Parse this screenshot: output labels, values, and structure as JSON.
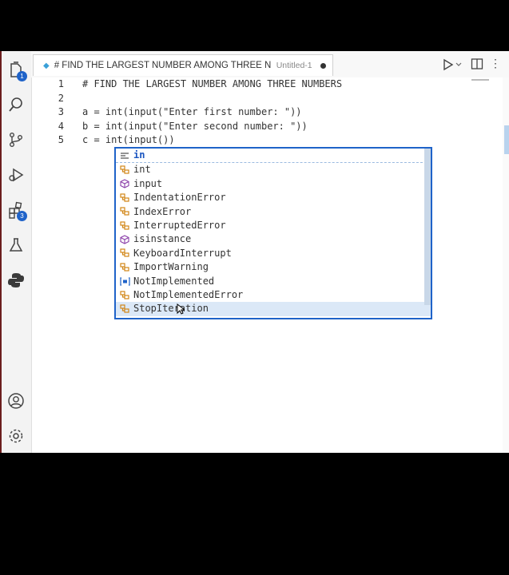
{
  "window": {
    "tab": {
      "title": "# FIND THE LARGEST NUMBER AMONG THREE NU",
      "description": "Untitled-1"
    }
  },
  "activity_bar": {
    "explorer_badge": "1",
    "extensions_badge": "3"
  },
  "editor": {
    "lines": [
      {
        "num": "1",
        "text": "# FIND THE LARGEST NUMBER AMONG THREE NUMBERS"
      },
      {
        "num": "2",
        "text": ""
      },
      {
        "num": "3",
        "text": "a = int(input(\"Enter first number: \"))"
      },
      {
        "num": "4",
        "text": "b = int(input(\"Enter second number: \"))"
      },
      {
        "num": "5",
        "text": "c = int(input())"
      }
    ]
  },
  "suggestions": [
    {
      "label": "in",
      "kind": "keyword"
    },
    {
      "label": "int",
      "kind": "class"
    },
    {
      "label": "input",
      "kind": "function"
    },
    {
      "label": "IndentationError",
      "kind": "class"
    },
    {
      "label": "IndexError",
      "kind": "class"
    },
    {
      "label": "InterruptedError",
      "kind": "class"
    },
    {
      "label": "isinstance",
      "kind": "function"
    },
    {
      "label": "KeyboardInterrupt",
      "kind": "class"
    },
    {
      "label": "ImportWarning",
      "kind": "class"
    },
    {
      "label": "NotImplemented",
      "kind": "variable"
    },
    {
      "label": "NotImplementedError",
      "kind": "class"
    },
    {
      "label": "StopIteration",
      "kind": "class"
    }
  ],
  "colors": {
    "accent": "#1f63c9",
    "class_icon": "#d18616",
    "function_icon": "#8a3ea8"
  }
}
